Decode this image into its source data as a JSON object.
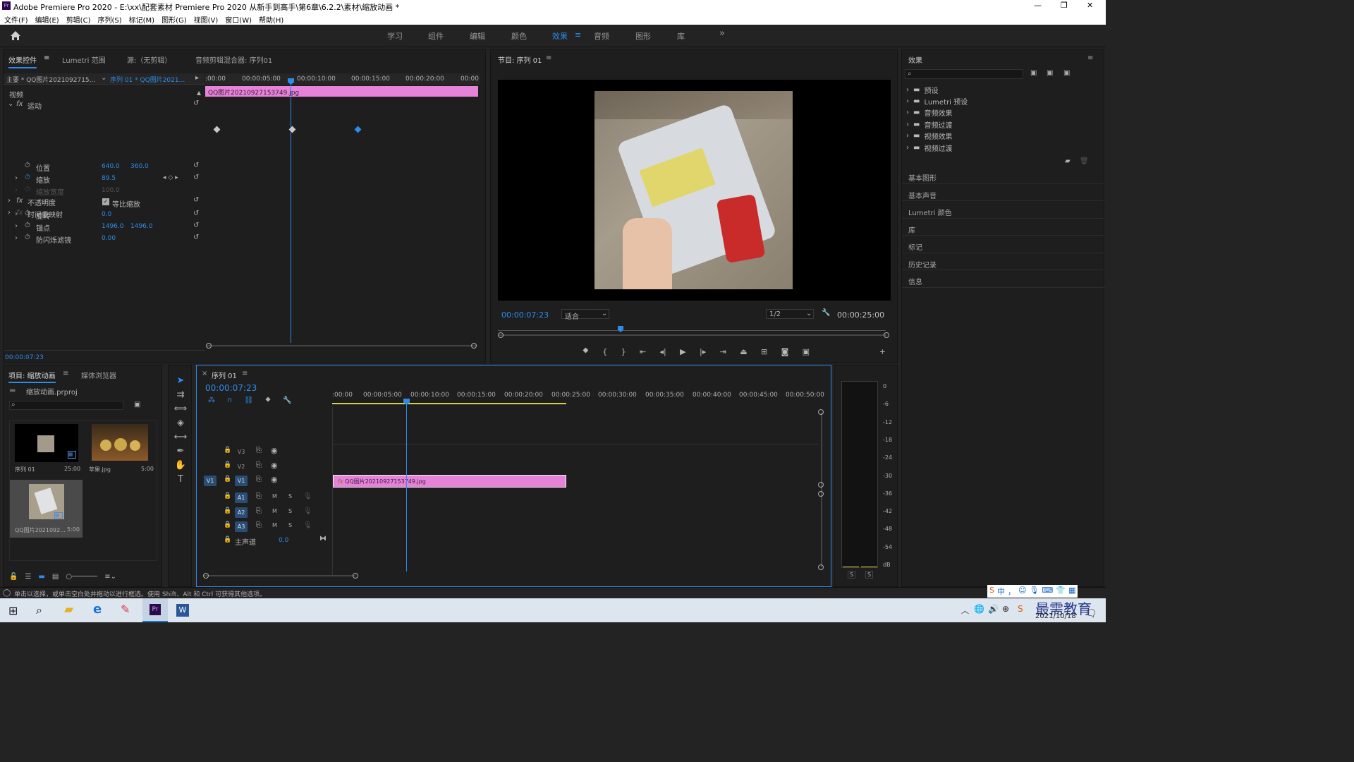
{
  "window": {
    "title": "Adobe Premiere Pro 2020 - E:\\xx\\配套素材 Premiere Pro 2020 从新手到高手\\第6章\\6.2.2\\素材\\缩放动画 *",
    "controls": [
      "—",
      "❐",
      "✕"
    ]
  },
  "menu": [
    "文件(F)",
    "编辑(E)",
    "剪辑(C)",
    "序列(S)",
    "标记(M)",
    "图形(G)",
    "视图(V)",
    "窗口(W)",
    "帮助(H)"
  ],
  "workspaces": [
    "学习",
    "组件",
    "编辑",
    "颜色",
    "效果",
    "音频",
    "图形",
    "库"
  ],
  "active_workspace": "效果",
  "more": "»",
  "effect_controls": {
    "tabs": [
      "效果控件",
      "Lumetri 范围",
      "源:（无剪辑）",
      "音频剪辑混合器: 序列01"
    ],
    "master": "主要 * QQ图片202109271​5...",
    "seq": "序列 01 * QQ图片2021...",
    "ruler": [
      ":00:00",
      "00:00:05:00",
      "00:00:10:00",
      "00:00:15:00",
      "00:00:20:00",
      "00:00"
    ],
    "clip": "QQ图片20210927153749.jpg",
    "video": "视频",
    "motion": "运动",
    "rows": [
      {
        "label": "位置",
        "v1": "640.0",
        "v2": "360.0"
      },
      {
        "label": "缩放",
        "v1": "89.5",
        "v2": ""
      },
      {
        "label": "缩放宽度",
        "v1": "100.0",
        "v2": ""
      },
      {
        "label": "等比缩放",
        "v1": "",
        "v2": ""
      },
      {
        "label": "旋转",
        "v1": "0.0",
        "v2": ""
      },
      {
        "label": "锚点",
        "v1": "1496.0",
        "v2": "1496.0"
      },
      {
        "label": "防闪烁滤镜",
        "v1": "0.00",
        "v2": ""
      }
    ],
    "opacity": "不透明度",
    "timeremap": "时间重映射",
    "timecode": "00:00:07:23"
  },
  "program": {
    "title": "节目: 序列 01",
    "timecode": "00:00:07:23",
    "fit": "适合",
    "quality": "1/2",
    "duration": "00:00:25:00"
  },
  "effects": {
    "title": "效果",
    "folders": [
      "预设",
      "Lumetri 预设",
      "音频效果",
      "音频过渡",
      "视频效果",
      "视频过渡"
    ],
    "panels": [
      "基本图形",
      "基本声音",
      "Lumetri 颜色",
      "库",
      "标记",
      "历史记录",
      "信息"
    ]
  },
  "project": {
    "tabs": [
      "项目: 缩放动画",
      "媒体浏览器"
    ],
    "file": "缩放动画.prproj",
    "items": [
      {
        "name": "序列 01",
        "dur": "25:00"
      },
      {
        "name": "苹果.jpg",
        "dur": "5:00"
      },
      {
        "name": "QQ图片2021092...",
        "dur": "5:00"
      }
    ]
  },
  "timeline": {
    "title": "序列 01",
    "timecode": "00:00:07:23",
    "ruler": [
      ":00:00",
      "00:00:05:00",
      "00:00:10:00",
      "00:00:15:00",
      "00:00:20:00",
      "00:00:25:00",
      "00:00:30:00",
      "00:00:35:00",
      "00:00:40:00",
      "00:00:45:00",
      "00:00:50:00"
    ],
    "tracks": [
      "V3",
      "V2",
      "V1",
      "A1",
      "A2",
      "A3"
    ],
    "clip": "QQ图片20210927153749.jpg",
    "master": "主声道",
    "master_val": "0.0"
  },
  "meter": {
    "scale": [
      "0",
      "-6",
      "-12",
      "-18",
      "-24",
      "-30",
      "-36",
      "-42",
      "-48",
      "-54",
      "dB"
    ],
    "solo": [
      "S",
      "S"
    ]
  },
  "status": "单击以选择，或单击空白处并拖动以进行框选。使用 Shift、Alt 和 Ctrl 可获得其他选项。",
  "taskbar": {
    "date": "2021/10/18",
    "time": "...",
    "watermark": "最需教育",
    "ime": "中"
  }
}
